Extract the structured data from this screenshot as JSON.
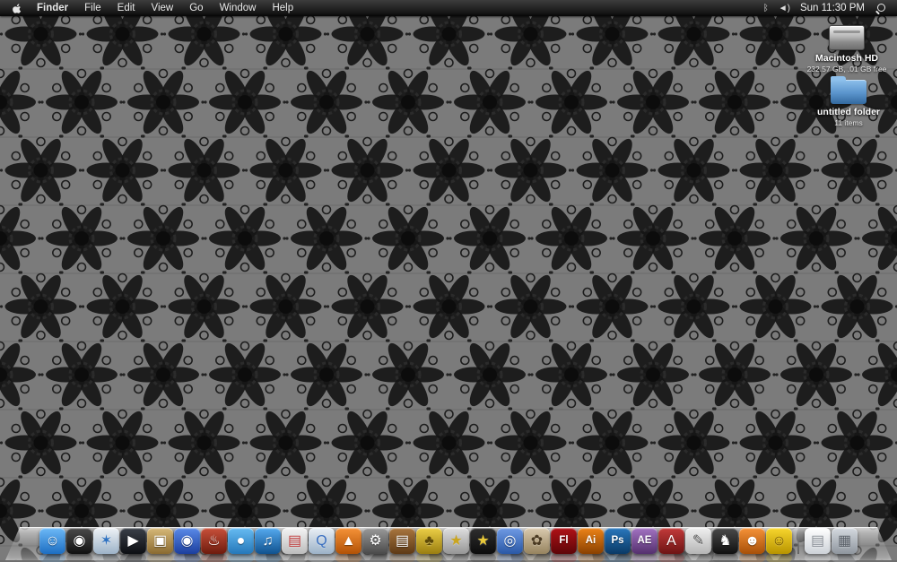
{
  "menu_bar": {
    "app_name": "Finder",
    "items": [
      "Finder",
      "File",
      "Edit",
      "View",
      "Go",
      "Window",
      "Help"
    ],
    "status": {
      "bluetooth_glyph": "ᛒ",
      "volume_glyph": "◄)",
      "clock": "Sun 11:30 PM"
    },
    "icons": [
      "apple-logo",
      "bluetooth-icon",
      "volume-icon",
      "spotlight-icon"
    ]
  },
  "desktop": {
    "wallpaper": {
      "bg": "#7b7b7b",
      "motif": "#161616",
      "accent": "#2b2b2b"
    },
    "icons": [
      {
        "name": "macintosh-hd",
        "label": "Macintosh HD",
        "sublabel": "232.57 GB, .01 GB free"
      },
      {
        "name": "untitled-folder",
        "label": "untitled folder",
        "sublabel": "11 items"
      }
    ]
  },
  "dock": {
    "items": [
      {
        "name": "finder",
        "glyph": "☺",
        "c1": "#6db9f7",
        "c2": "#1d6ec2"
      },
      {
        "name": "dashboard",
        "glyph": "◉",
        "c1": "#4a4a4a",
        "c2": "#111111"
      },
      {
        "name": "safari",
        "glyph": "✶",
        "c1": "#eef2f6",
        "c2": "#9db3c8",
        "fg": "#2a6fc0"
      },
      {
        "name": "dvd-player",
        "glyph": "▶",
        "c1": "#3a3f48",
        "c2": "#0d0f13"
      },
      {
        "name": "photo-booth",
        "glyph": "▣",
        "c1": "#d6b878",
        "c2": "#8a6a30"
      },
      {
        "name": "front-row",
        "glyph": "◉",
        "c1": "#5a8ae8",
        "c2": "#1c3f9e"
      },
      {
        "name": "toast",
        "glyph": "♨",
        "c1": "#c8503a",
        "c2": "#6e1c0e"
      },
      {
        "name": "video-chat",
        "glyph": "●",
        "c1": "#66bbf2",
        "c2": "#2578ba"
      },
      {
        "name": "itunes",
        "glyph": "♫",
        "c1": "#55aaef",
        "c2": "#10528f"
      },
      {
        "name": "ical",
        "glyph": "▤",
        "c1": "#f4f4f4",
        "c2": "#bcbcbc",
        "fg": "#c03a3a"
      },
      {
        "name": "quicktime",
        "glyph": "Q",
        "c1": "#e9eff5",
        "c2": "#9cb2c8",
        "fg": "#3a6fc0"
      },
      {
        "name": "vlc",
        "glyph": "▲",
        "c1": "#f59238",
        "c2": "#b35206"
      },
      {
        "name": "system-preferences",
        "glyph": "⚙",
        "c1": "#9a9a9a",
        "c2": "#4a4a4a"
      },
      {
        "name": "address-book",
        "glyph": "▤",
        "c1": "#a9763e",
        "c2": "#5e3a16"
      },
      {
        "name": "pineapple-game",
        "glyph": "♣",
        "c1": "#eccf46",
        "c2": "#9a7e10",
        "fg": "#5e4a08"
      },
      {
        "name": "star-app",
        "glyph": "★",
        "c1": "#dedede",
        "c2": "#969696",
        "fg": "#caa520"
      },
      {
        "name": "imovie",
        "glyph": "★",
        "c1": "#2f2f2f",
        "c2": "#0c0c0c",
        "fg": "#e8c838"
      },
      {
        "name": "iweb",
        "glyph": "◎",
        "c1": "#6f9ae4",
        "c2": "#2a58a6"
      },
      {
        "name": "aperture",
        "glyph": "✿",
        "c1": "#d9c9ae",
        "c2": "#97845f",
        "fg": "#4a3a22"
      },
      {
        "name": "flash",
        "glyph": "Fl",
        "c1": "#b01217",
        "c2": "#5e0508"
      },
      {
        "name": "illustrator",
        "glyph": "Ai",
        "c1": "#ec8318",
        "c2": "#8a4100"
      },
      {
        "name": "photoshop",
        "glyph": "Ps",
        "c1": "#2a77bc",
        "c2": "#0a3a66"
      },
      {
        "name": "after-effects",
        "glyph": "AE",
        "c1": "#a273c2",
        "c2": "#55306e"
      },
      {
        "name": "dictionary",
        "glyph": "A",
        "c1": "#c23a3a",
        "c2": "#6e1414"
      },
      {
        "name": "textedit",
        "glyph": "✎",
        "c1": "#efefef",
        "c2": "#b5b5b5",
        "fg": "#555555"
      },
      {
        "name": "chess",
        "glyph": "♞",
        "c1": "#4a4a4a",
        "c2": "#101010"
      },
      {
        "name": "orange-app",
        "glyph": "☻",
        "c1": "#f59238",
        "c2": "#a85008"
      },
      {
        "name": "smiley-app",
        "glyph": "☺",
        "c1": "#f7d62e",
        "c2": "#b89400",
        "fg": "#6e5200"
      },
      {
        "name": "documents-stack",
        "glyph": "▤",
        "c1": "#ffffff",
        "c2": "#cdd2d8",
        "fg": "#8a8f96",
        "divider_before": true
      },
      {
        "name": "trash",
        "glyph": "▦",
        "c1": "#d4d9df",
        "c2": "#8f969e",
        "fg": "#5a6068"
      }
    ]
  }
}
